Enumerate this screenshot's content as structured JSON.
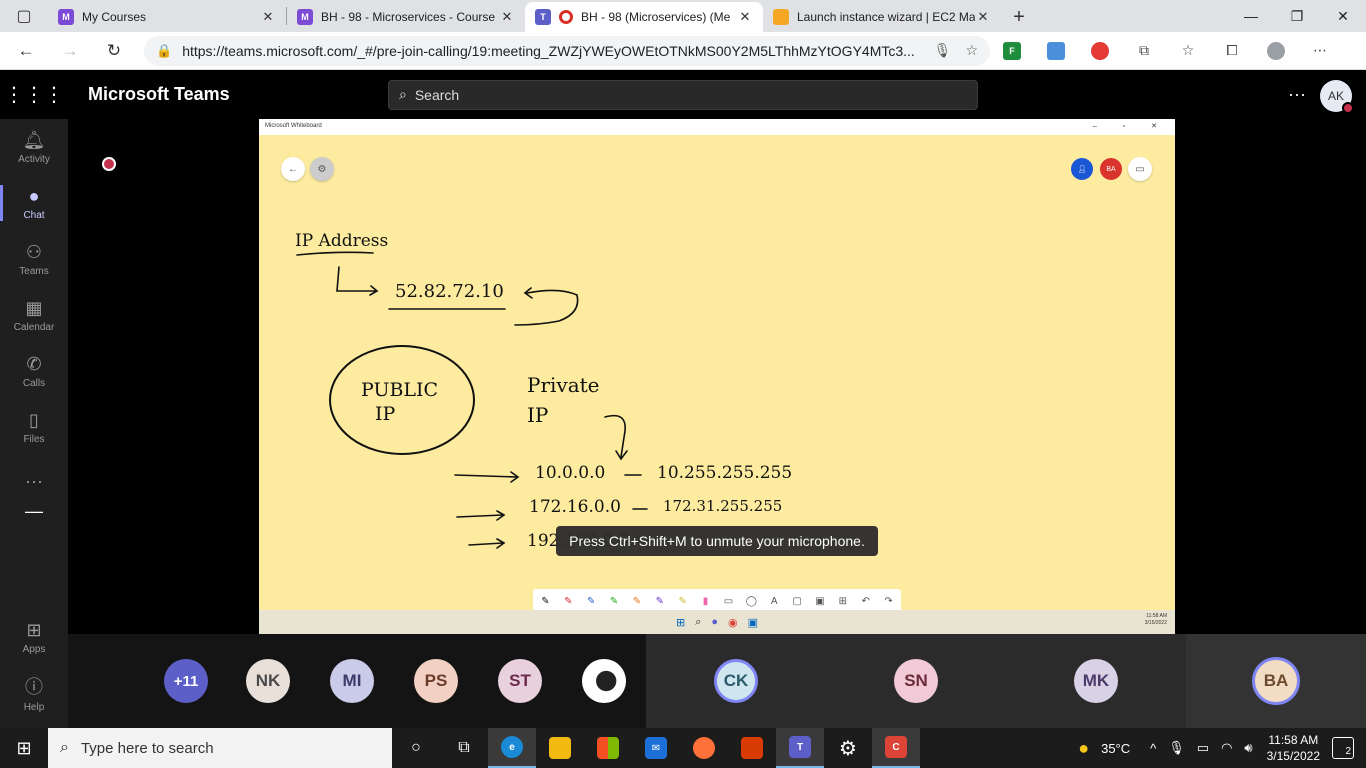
{
  "browser": {
    "tabs": [
      {
        "title": "My Courses",
        "fav_color": "#7b4bd6",
        "fav_glyph": "M"
      },
      {
        "title": "BH - 98 - Microservices - Course",
        "fav_color": "#7b4bd6",
        "fav_glyph": "M"
      },
      {
        "title": "BH - 98 (Microservices) (Me",
        "fav_color": "#5b5fc7",
        "fav_glyph": "T"
      },
      {
        "title": "Launch instance wizard | EC2 Ma",
        "fav_color": "#f5a623",
        "fav_glyph": "■"
      }
    ],
    "url": "https://teams.microsoft.com/_#/pre-join-calling/19:meeting_ZWZjYWEyOWEtOTNkMS00Y2M5LThhMzYtOGY4MTc3..."
  },
  "teams": {
    "brand": "Microsoft Teams",
    "search_placeholder": "Search",
    "me_initials": "AK",
    "rail": [
      {
        "label": "Activity",
        "icon": "bell-icon",
        "glyph": "🔔"
      },
      {
        "label": "Chat",
        "icon": "chat-icon",
        "glyph": "💬"
      },
      {
        "label": "Teams",
        "icon": "teams-icon",
        "glyph": "👥"
      },
      {
        "label": "Calendar",
        "icon": "calendar-icon",
        "glyph": "📅"
      },
      {
        "label": "Calls",
        "icon": "phone-icon",
        "glyph": "📞"
      },
      {
        "label": "Files",
        "icon": "file-icon",
        "glyph": "📄"
      }
    ],
    "rail_bottom": [
      {
        "label": "Apps",
        "icon": "apps-icon",
        "glyph": "⊞"
      },
      {
        "label": "Help",
        "icon": "help-icon",
        "glyph": "?"
      }
    ]
  },
  "whiteboard": {
    "app_title": "Microsoft Whiteboard",
    "avatar_ba": "BA",
    "notes": {
      "ip_address": "IP Address",
      "ip_value": "52.82.72.10",
      "public_ip_1": "PUBLIC",
      "public_ip_2": "IP",
      "private_1": "Private",
      "private_2": "IP",
      "range1_start": "10.0.0.0",
      "range1_end": "10.255.255.255",
      "range2_start": "172.16.0.0",
      "range2_end": "172.31.255.255",
      "range3_start": "192.168.0.0"
    },
    "inner_clock_time": "11:58 AM",
    "inner_clock_date": "3/15/2022"
  },
  "toast": "Press Ctrl+Shift+M to unmute your microphone.",
  "participants": [
    {
      "initials": "+11",
      "bg": "#5b5fc7",
      "fg": "#ffffff"
    },
    {
      "initials": "NK",
      "bg": "#e8e0d8",
      "fg": "#4a4a4a"
    },
    {
      "initials": "MI",
      "bg": "#c9cbe8",
      "fg": "#3b3b6b"
    },
    {
      "initials": "PS",
      "bg": "#f2d0c4",
      "fg": "#6b3b2b"
    },
    {
      "initials": "ST",
      "bg": "#e8d0dc",
      "fg": "#6b2b4b"
    },
    {
      "initials": "",
      "bg": "#ffffff",
      "fg": "#000000"
    },
    {
      "initials": "CK",
      "bg": "#cfe6ef",
      "fg": "#2b5b6b"
    },
    {
      "initials": "SN",
      "bg": "#f2c9d6",
      "fg": "#6b2b3b"
    },
    {
      "initials": "MK",
      "bg": "#d9d2e6",
      "fg": "#4b3b6b"
    },
    {
      "initials": "BA",
      "bg": "#f2dcc4",
      "fg": "#6b4b2b"
    }
  ],
  "taskbar": {
    "search_placeholder": "Type here to search",
    "weather": "35°C",
    "time": "11:58 AM",
    "date": "3/15/2022",
    "notifications": "2"
  }
}
